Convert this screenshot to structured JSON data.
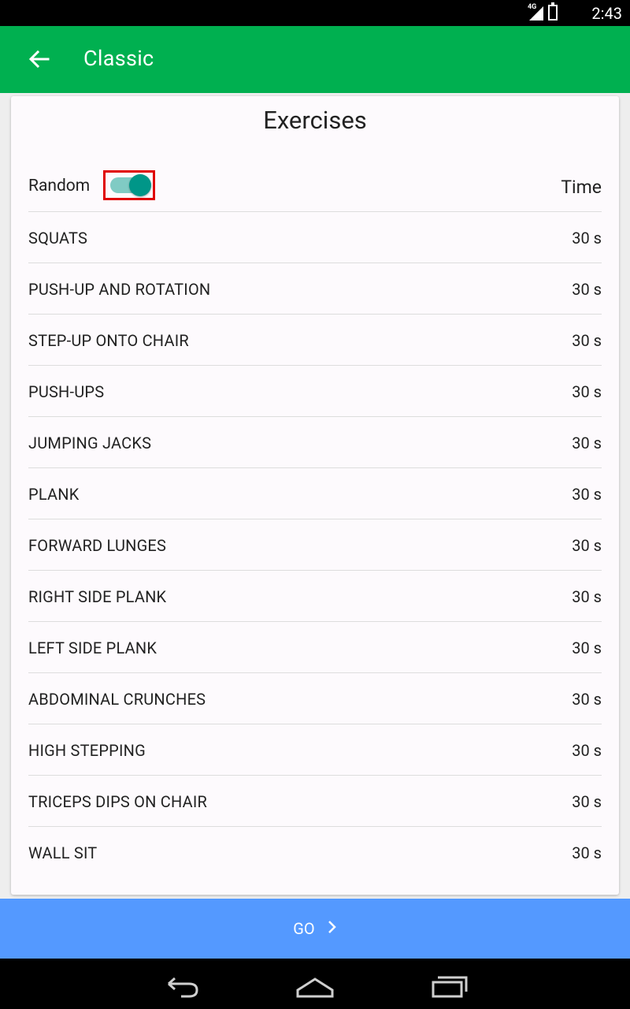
{
  "status_bar": {
    "time": "2:43",
    "network": "4G",
    "icons": [
      "signal-icon",
      "battery-icon"
    ]
  },
  "app_bar": {
    "title": "Classic",
    "back_icon": "arrow-left-icon",
    "color": "#00b050"
  },
  "card": {
    "title": "Exercises",
    "random_label": "Random",
    "random_on": true,
    "time_header": "Time",
    "exercises": [
      {
        "name": "SQUATS",
        "time": "30 s"
      },
      {
        "name": "PUSH-UP AND ROTATION",
        "time": "30 s"
      },
      {
        "name": "STEP-UP ONTO CHAIR",
        "time": "30 s"
      },
      {
        "name": "PUSH-UPS",
        "time": "30 s"
      },
      {
        "name": "JUMPING JACKS",
        "time": "30 s"
      },
      {
        "name": "PLANK",
        "time": "30 s"
      },
      {
        "name": "FORWARD LUNGES",
        "time": "30 s"
      },
      {
        "name": "RIGHT SIDE PLANK",
        "time": "30 s"
      },
      {
        "name": "LEFT SIDE PLANK",
        "time": "30 s"
      },
      {
        "name": "ABDOMINAL CRUNCHES",
        "time": "30 s"
      },
      {
        "name": "HIGH STEPPING",
        "time": "30 s"
      },
      {
        "name": "TRICEPS DIPS ON CHAIR",
        "time": "30 s"
      },
      {
        "name": "WALL SIT",
        "time": "30 s"
      }
    ]
  },
  "go_button": {
    "label": "GO",
    "icon": "chevron-right-icon",
    "color": "#5499ff"
  },
  "nav_bar": {
    "icons": [
      "back-nav-icon",
      "home-nav-icon",
      "recent-apps-icon"
    ]
  }
}
